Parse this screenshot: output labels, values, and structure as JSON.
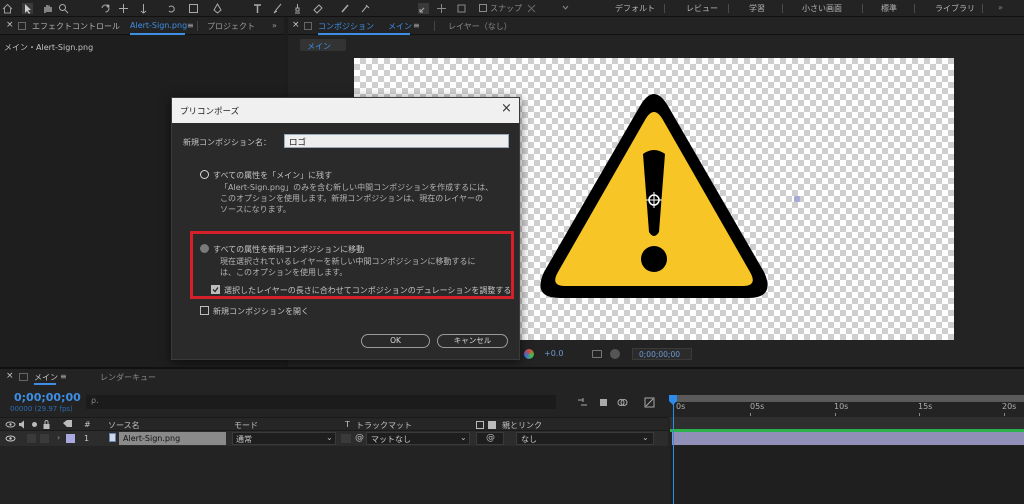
{
  "workspaces": [
    "デフォルト",
    "レビュー",
    "学習",
    "小さい画面",
    "標準",
    "ライブラリ"
  ],
  "toolbar": {
    "snap_label": "スナップ"
  },
  "left_panel": {
    "tab_effects": "エフェクトコントロール",
    "tab_effects_file": "Alert-Sign.png",
    "tab_project": "プロジェクト",
    "layer_path": "メイン・Alert-Sign.png"
  },
  "comp_panel": {
    "tab_label": "コンポジション",
    "tab_comp_name": "メイン",
    "tab_layer": "レイヤー（なし）",
    "breadcrumb": "メイン",
    "bottom_zoom": "+0.0",
    "bottom_time": "0;00;00;00"
  },
  "dialog": {
    "title": "プリコンポーズ",
    "name_label": "新規コンポジション名：",
    "name_value": "ロゴ",
    "option1_label": "すべての属性を「メイン」に残す",
    "option1_desc_1": "「Alert-Sign.png」のみを含む新しい中間コンポジションを作成するには、",
    "option1_desc_2": "このオプションを使用します。新規コンポジションは、現在のレイヤーの",
    "option1_desc_3": "ソースになります。",
    "option2_label": "すべての属性を新規コンポジションに移動",
    "option2_desc_1": "現在選択されているレイヤーを新しい中間コンポジションに移動するに",
    "option2_desc_2": "は、このオプションを使用します。",
    "adjust_duration_label": "選択したレイヤーの長さに合わせてコンポジションのデュレーションを調整する",
    "open_new_comp_label": "新規コンポジションを開く",
    "ok_label": "OK",
    "cancel_label": "キャンセル",
    "highlight_color": "#d4202a"
  },
  "timeline": {
    "tab_comp": "メイン",
    "tab_render": "レンダーキュー",
    "timecode": "0;00;00;00",
    "frame_info": "00000 (29.97 fps)",
    "search_placeholder": "ρ.",
    "columns": {
      "hash": "#",
      "source_name": "ソース名",
      "mode": "モード",
      "t": "T",
      "track_matte": "トラックマット",
      "parent_link": "親とリンク"
    },
    "ruler": [
      "0s",
      "05s",
      "10s",
      "15s",
      "20s"
    ],
    "layer": {
      "number": "1",
      "name": "Alert-Sign.png",
      "mode": "通常",
      "track_matte": "マットなし",
      "parent": "なし"
    },
    "accent_color": "#2d8ceb",
    "layer_bar_color": "#8f8fb8"
  }
}
